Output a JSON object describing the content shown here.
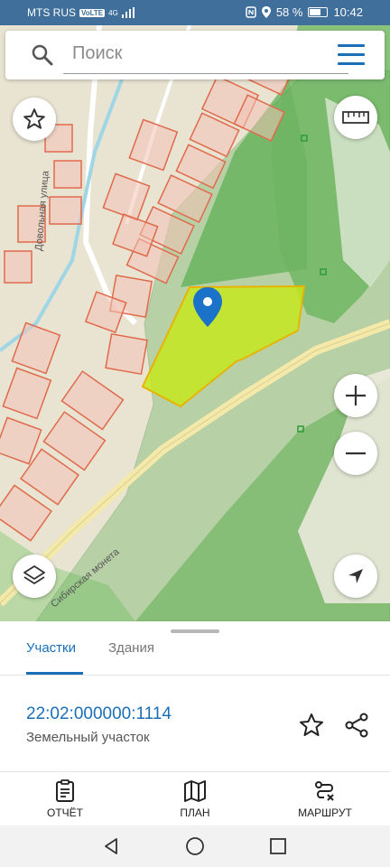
{
  "status_bar": {
    "carrier": "MTS RUS",
    "volte_badge": "VoLTE",
    "network": "4G",
    "battery": "58 %",
    "battery_level": 0.58,
    "time": "10:42"
  },
  "search": {
    "placeholder": "Поиск"
  },
  "map": {
    "street_label_1": "Довольная улица",
    "street_label_2": "Сибирская монета",
    "marker_color": "#1a73c8",
    "plot_color": "#c6e81e"
  },
  "sheet": {
    "tabs": [
      {
        "label": "Участки",
        "active": true
      },
      {
        "label": "Здания",
        "active": false
      }
    ],
    "cadastral_number": "22:02:000000:1114",
    "object_type": "Земельный участок"
  },
  "bottom_nav": {
    "items": [
      {
        "label": "ОТЧЁТ",
        "icon": "report-icon"
      },
      {
        "label": "ПЛАН",
        "icon": "map-icon"
      },
      {
        "label": "МАРШРУТ",
        "icon": "route-icon"
      }
    ]
  },
  "colors": {
    "accent": "#1a6fb8",
    "status_bar": "#3f6f9a"
  }
}
